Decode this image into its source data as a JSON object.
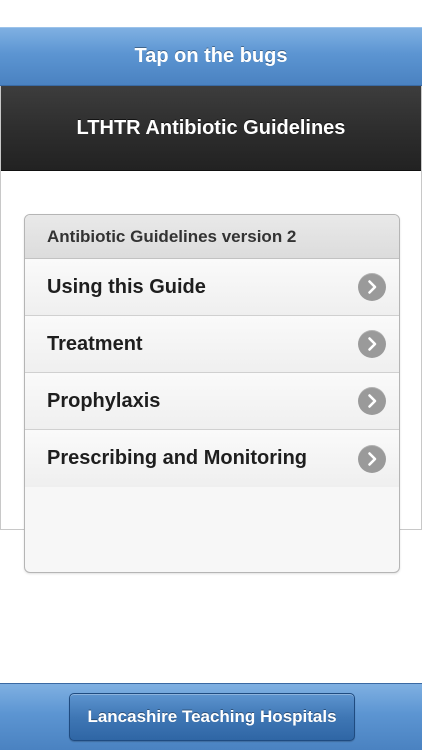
{
  "header": {
    "title": "Tap on the bugs"
  },
  "banner": {
    "title": "LTHTR Antibiotic Guidelines"
  },
  "list": {
    "divider": "Antibiotic Guidelines version 2",
    "items": [
      {
        "label": "Using this Guide"
      },
      {
        "label": "Treatment"
      },
      {
        "label": "Prophylaxis"
      },
      {
        "label": "Prescribing and Monitoring"
      }
    ]
  },
  "footer": {
    "button_label": "Lancashire Teaching Hospitals"
  },
  "icons": {
    "list_item_arrow": "chevron-right-icon"
  },
  "colors": {
    "header_blue": "#5c95d2",
    "banner_dark": "#2e2e2e",
    "chevron_gray": "#9a9a9a"
  }
}
